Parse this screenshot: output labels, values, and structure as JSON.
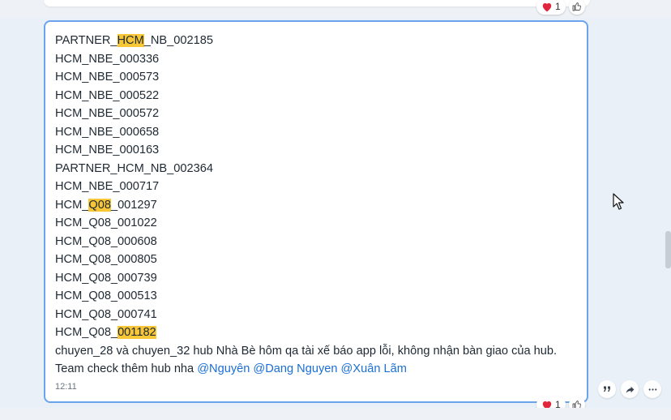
{
  "message": {
    "codes": [
      [
        {
          "t": "PARTNER_"
        },
        {
          "t": "HCM",
          "hl": true
        },
        {
          "t": "_NB_002185"
        }
      ],
      [
        {
          "t": "HCM_NBE_000336"
        }
      ],
      [
        {
          "t": "HCM_NBE_000573"
        }
      ],
      [
        {
          "t": "HCM_NBE_000522"
        }
      ],
      [
        {
          "t": "HCM_NBE_000572"
        }
      ],
      [
        {
          "t": "HCM_NBE_000658"
        }
      ],
      [
        {
          "t": "HCM_NBE_000163"
        }
      ],
      [
        {
          "t": "PARTNER_HCM_NB_002364"
        }
      ],
      [
        {
          "t": "HCM_NBE_000717"
        }
      ],
      [
        {
          "t": "HCM_"
        },
        {
          "t": "Q08",
          "hl": true
        },
        {
          "t": "_001297"
        }
      ],
      [
        {
          "t": "HCM_Q08_001022"
        }
      ],
      [
        {
          "t": "HCM_Q08_000608"
        }
      ],
      [
        {
          "t": "HCM_Q08_000805"
        }
      ],
      [
        {
          "t": "HCM_Q08_000739"
        }
      ],
      [
        {
          "t": "HCM_Q08_000513"
        }
      ],
      [
        {
          "t": "HCM_Q08_000741"
        }
      ],
      [
        {
          "t": "HCM_Q08_"
        },
        {
          "t": "001182",
          "hl": true
        }
      ]
    ],
    "body_line1": "chuyen_28 và chuyen_32 hub Nhà Bè hôm qa tài xế báo app lỗi, không nhận bàn giao của hub.",
    "body_line2_prefix": "Team check thêm hub nha ",
    "mentions": [
      "@Nguyên",
      "@Dang Nguyen",
      "@Xuân Lãm"
    ],
    "time": "12:11"
  },
  "reactions": {
    "top": {
      "emoji": "heart-icon",
      "count": "1"
    },
    "bottom": {
      "emoji": "heart-icon",
      "count": "1"
    }
  },
  "colors": {
    "highlight": "#f8c738",
    "mention": "#1a6fd6",
    "bubble_border": "#6ba4ec",
    "heart": "#e0263c"
  }
}
